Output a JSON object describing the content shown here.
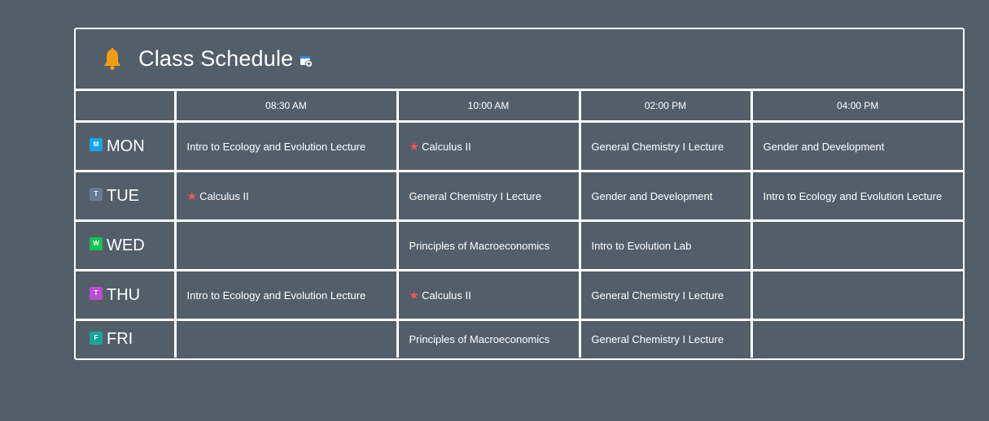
{
  "header": {
    "title": "Class Schedule",
    "bell_icon": "bell-icon",
    "calendar_icon": "calendar-add-icon"
  },
  "times": [
    "08:30 AM",
    "10:00 AM",
    "02:00 PM",
    "04:00 PM"
  ],
  "days": [
    {
      "code": "M",
      "label": "MON",
      "color": "#14a6e8",
      "cells": [
        {
          "text": "Intro to Ecology and Evolution Lecture",
          "star": false
        },
        {
          "text": "Calculus II",
          "star": true
        },
        {
          "text": "General Chemistry I Lecture",
          "star": false
        },
        {
          "text": "Gender and Development",
          "star": false
        }
      ]
    },
    {
      "code": "T",
      "label": "TUE",
      "color": "#6b7a93",
      "cells": [
        {
          "text": "Calculus II",
          "star": true
        },
        {
          "text": "General Chemistry I Lecture",
          "star": false
        },
        {
          "text": "Gender and Development",
          "star": false
        },
        {
          "text": "Intro to Ecology and Evolution Lecture",
          "star": false
        }
      ]
    },
    {
      "code": "W",
      "label": "WED",
      "color": "#12c34f",
      "cells": [
        {
          "text": "",
          "star": false
        },
        {
          "text": "Principles of Macroeconomics",
          "star": false
        },
        {
          "text": "Intro to Evolution Lab",
          "star": false
        },
        {
          "text": "",
          "star": false
        }
      ]
    },
    {
      "code": "T",
      "label": "THU",
      "color": "#b84fd0",
      "cells": [
        {
          "text": "Intro to Ecology and Evolution Lecture",
          "star": false
        },
        {
          "text": "Calculus II",
          "star": true
        },
        {
          "text": "General Chemistry I Lecture",
          "star": false
        },
        {
          "text": "",
          "star": false
        }
      ]
    },
    {
      "code": "F",
      "label": "FRI",
      "color": "#1aa59a",
      "cells": [
        {
          "text": "",
          "star": false
        },
        {
          "text": "Principles of Macroeconomics",
          "star": false
        },
        {
          "text": "General Chemistry I Lecture",
          "star": false
        },
        {
          "text": "",
          "star": false
        }
      ]
    }
  ],
  "colors": {
    "background": "#525f6b",
    "border": "#ffffff",
    "star": "#f05555",
    "bell": "#f39c12"
  }
}
